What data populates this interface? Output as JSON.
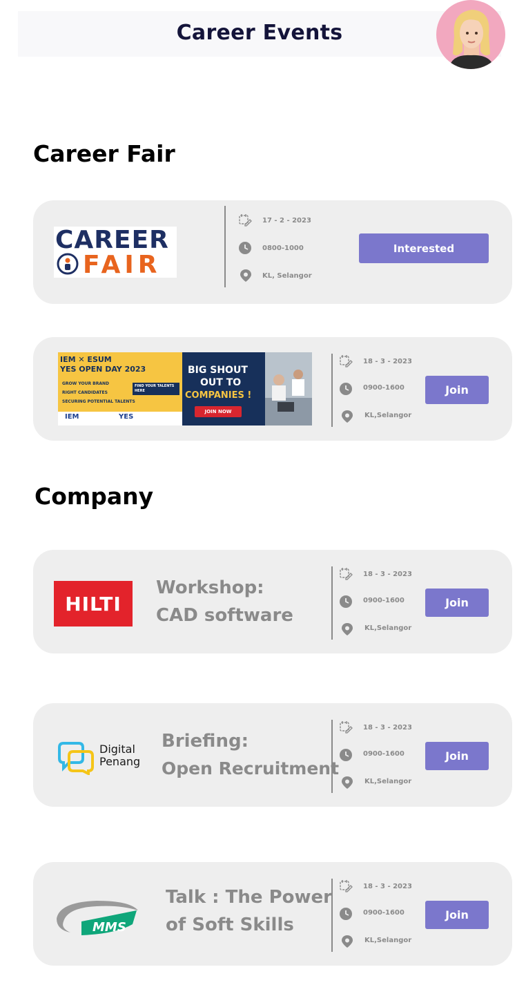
{
  "header": {
    "title": "Career Events"
  },
  "sections": {
    "career_fair": "Career Fair",
    "company": "Company"
  },
  "career_fair_card": {
    "logo_top": "CAREER",
    "logo_bottom": "FAIR",
    "date": "17 - 2 - 2023",
    "time": "0800-1000",
    "location": "KL, Selangor",
    "button": "Interested"
  },
  "open_day_card": {
    "banner": {
      "line1": "IEM ✕ ESUM",
      "line2": "YES OPEN DAY 2023",
      "bullet1": "GROW YOUR BRAND",
      "bullet2": "RIGHT CANDIDATES",
      "bullet3": "SECURING POTENTIAL TALENTS",
      "tag": "FIND YOUR TALENTS HERE",
      "shout1": "BIG SHOUT",
      "shout2": "OUT TO",
      "shout3": "COMPANIES !",
      "join": "JOIN NOW",
      "org1": "IEM",
      "org2": "YES"
    },
    "date": "18 - 3 - 2023",
    "time": "0900-1600",
    "location": "KL,Selangor",
    "button": "Join"
  },
  "company_cards": [
    {
      "logo_text": "HILTI",
      "title_line1": "Workshop:",
      "title_line2": "CAD software",
      "date": "18 - 3 - 2023",
      "time": "0900-1600",
      "location": "KL,Selangor",
      "button": "Join"
    },
    {
      "logo_text_line1": "Digital",
      "logo_text_line2": "Penang",
      "title_line1": "Briefing:",
      "title_line2": "Open Recruitment",
      "date": "18 - 3 - 2023",
      "time": "0900-1600",
      "location": "KL,Selangor",
      "button": "Join"
    },
    {
      "logo_text": "MMS",
      "title_line1": "Talk : The Power",
      "title_line2": "of Soft Skills",
      "date": "18 - 3 - 2023",
      "time": "0900-1600",
      "location": "KL,Selangor",
      "button": "Join"
    }
  ],
  "colors": {
    "accent": "#7b77cc",
    "card_bg": "#eeeeee",
    "muted_text": "#8a8a8a",
    "title_navy": "#14143a"
  }
}
